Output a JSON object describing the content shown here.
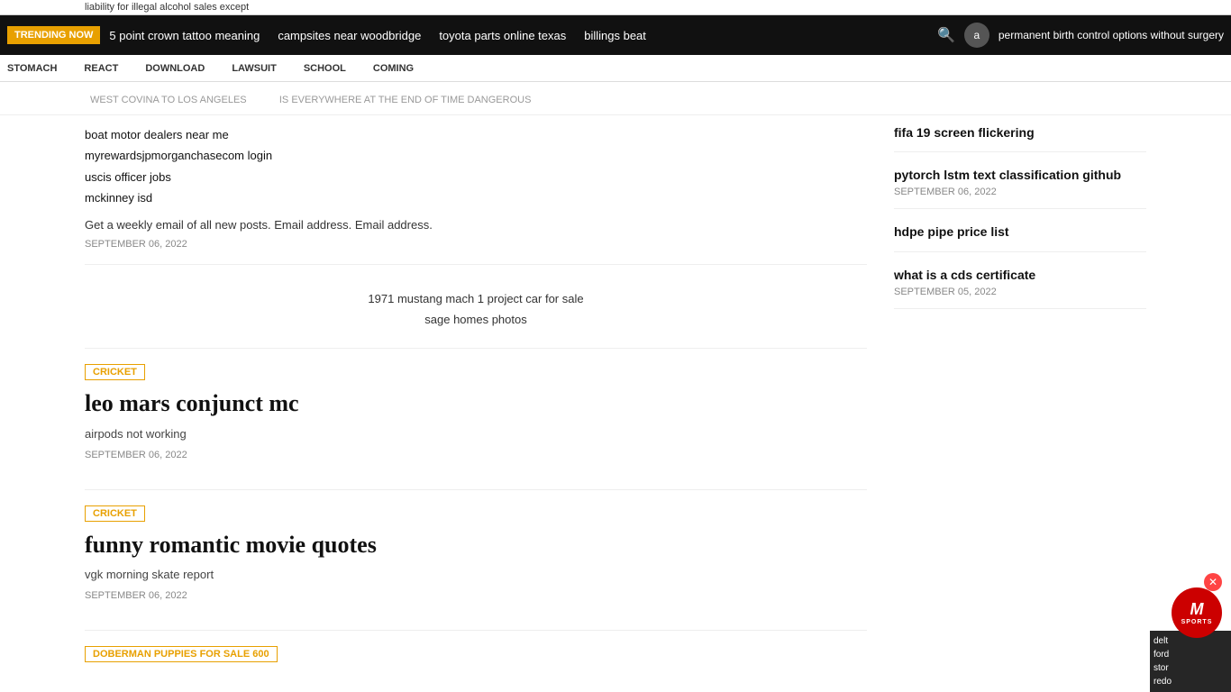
{
  "ticker": {
    "text": "liability for illegal alcohol sales except"
  },
  "topNav": {
    "trending_label": "TRENDING NOW",
    "links": [
      {
        "id": "link1",
        "text": "5 point crown tattoo meaning"
      },
      {
        "id": "link2",
        "text": "campsites near woodbridge"
      },
      {
        "id": "link3",
        "text": "toyota parts online texas"
      },
      {
        "id": "link4",
        "text": "billings beat"
      }
    ],
    "promo_text": "permanent birth control options without surgery",
    "avatar_text": "a"
  },
  "secondBar": {
    "links": [
      {
        "id": "s1",
        "text": "STOMACH"
      },
      {
        "id": "s2",
        "text": "REACT"
      },
      {
        "id": "s3",
        "text": "DOWNLOAD"
      },
      {
        "id": "s4",
        "text": "LAWSUIT"
      },
      {
        "id": "s5",
        "text": "SCHOOL"
      },
      {
        "id": "s6",
        "text": "COMING"
      }
    ]
  },
  "breadcrumb": {
    "part1": "WEST COVINA TO LOS ANGELES",
    "separator": "IS EVERYWHERE AT THE END OF TIME DANGEROUS"
  },
  "leftColumn": {
    "links": [
      {
        "id": "lc1",
        "text": "boat motor dealers near me"
      },
      {
        "id": "lc2",
        "text": "myrewardsjpmorganchasecom login"
      },
      {
        "id": "lc3",
        "text": "uscis officer jobs"
      },
      {
        "id": "lc4",
        "text": "mckinney isd"
      }
    ],
    "email_sub": "Get a weekly email of all new posts. Email address. Email address.",
    "date1": "SEPTEMBER 06, 2022",
    "center_links": [
      {
        "id": "cl1",
        "text": "1971 mustang mach 1 project car for sale"
      },
      {
        "id": "cl2",
        "text": "sage homes photos"
      }
    ],
    "articles": [
      {
        "id": "art1",
        "category": "CRICKET",
        "title": "leo mars conjunct mc",
        "subtitle": "airpods not working",
        "date": "SEPTEMBER 06, 2022"
      },
      {
        "id": "art2",
        "category": "CRICKET",
        "title": "funny romantic movie quotes",
        "subtitle": "vgk morning skate report",
        "date": "SEPTEMBER 06, 2022"
      },
      {
        "id": "art3",
        "category": "DOBERMAN PUPPIES FOR SALE 600",
        "title": "",
        "subtitle": "",
        "date": ""
      }
    ]
  },
  "rightColumn": {
    "items": [
      {
        "id": "rc1",
        "title": "fifa 19 screen flickering",
        "subtitle": "",
        "date": ""
      },
      {
        "id": "rc2",
        "title": "pytorch lstm text classification github",
        "subtitle": "",
        "date": "SEPTEMBER 06, 2022"
      },
      {
        "id": "rc3",
        "title": "hdpe pipe price list",
        "subtitle": "",
        "date": ""
      },
      {
        "id": "rc4",
        "title": "what is a cds certificate",
        "subtitle": "",
        "date": "SEPTEMBER 05, 2022"
      }
    ]
  },
  "floatingBadge": {
    "letter": "M",
    "label": "SPORTS"
  },
  "sidebarFloat": {
    "items": [
      {
        "id": "sf1",
        "text": "delt"
      },
      {
        "id": "sf2",
        "text": "ford"
      },
      {
        "id": "sf3",
        "text": "stor"
      },
      {
        "id": "sf4",
        "text": "redo"
      }
    ]
  }
}
